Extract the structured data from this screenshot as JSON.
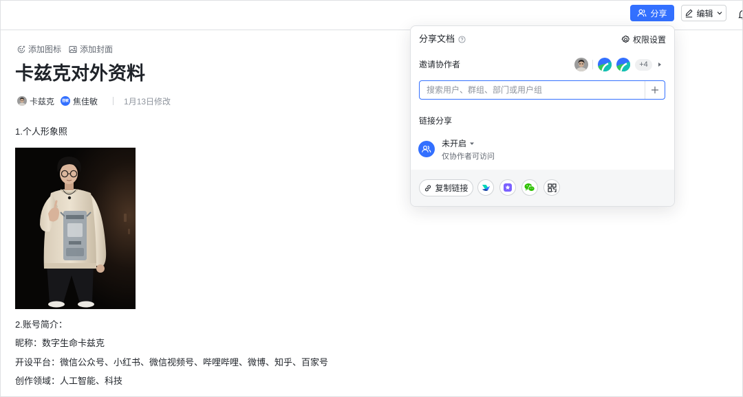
{
  "colors": {
    "accent": "#3370ff",
    "text_primary": "#1f2329",
    "text_secondary": "#646a73"
  },
  "topbar": {
    "share_button": {
      "label": "分享",
      "icon": "share-user-icon"
    },
    "edit_button": {
      "label": "编辑",
      "icon": "pencil-icon"
    },
    "notification_icon": "bell-icon"
  },
  "doc": {
    "add_icon_label": "添加图标",
    "add_cover_label": "添加封面",
    "title": "卡兹克对外资料",
    "authors": [
      {
        "name": "卡兹克"
      },
      {
        "name": "焦佳敏",
        "avatar_text": "佳敏"
      }
    ],
    "modified": "1月13日修改",
    "section_photo_heading": "1.个人形象照",
    "section_intro_heading": "2.账号简介：",
    "intro_lines": [
      "昵称：数字生命卡兹克",
      "开设平台：微信公众号、小红书、微信视频号、哔哩哔哩、微博、知乎、百家号",
      "创作领域：人工智能、科技"
    ]
  },
  "share_panel": {
    "title": "分享文档",
    "permission_settings": "权限设置",
    "invite_label": "邀请协作者",
    "more_collaborators": "+4",
    "search_placeholder": "搜索用户、群组、部门或用户组",
    "link_share_label": "链接分享",
    "link_status": "未开启",
    "link_scope": "仅协作者可访问",
    "copy_link": "复制链接",
    "share_targets": [
      "feishu-icon",
      "docs-app-icon",
      "wechat-icon",
      "qrcode-icon"
    ]
  }
}
